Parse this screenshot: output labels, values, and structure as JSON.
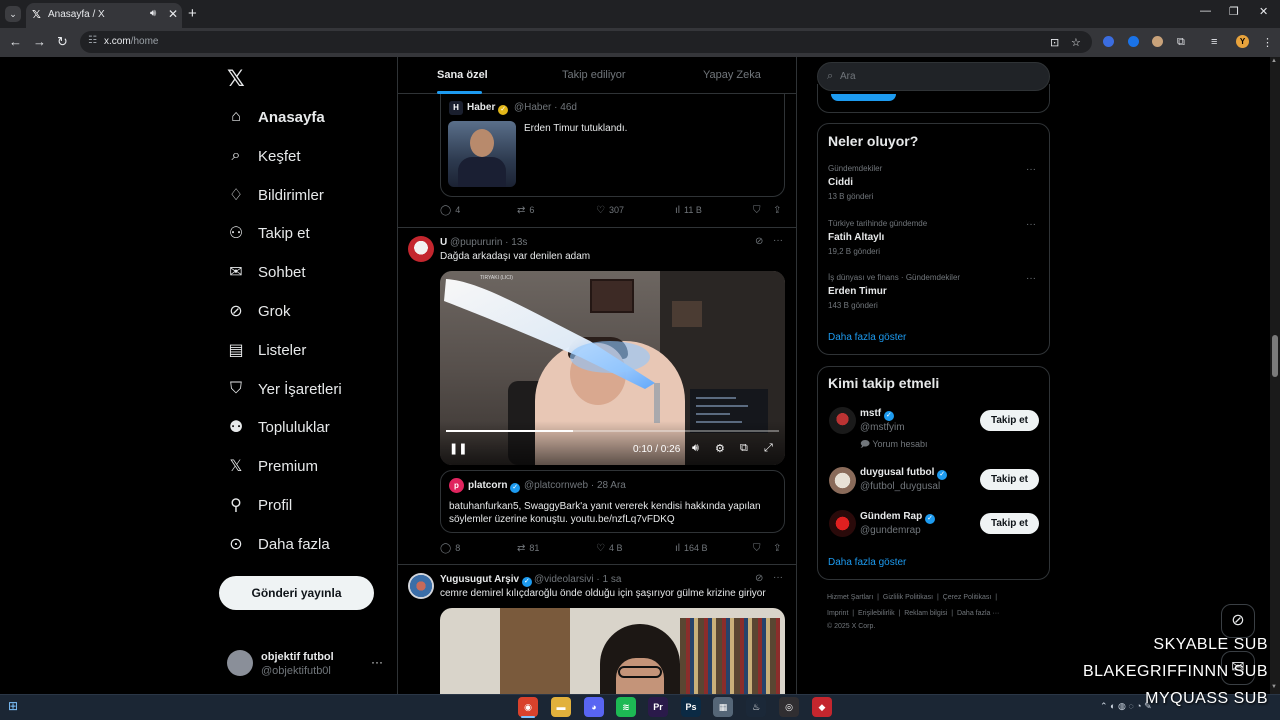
{
  "browser": {
    "tab_title": "Anasayfa / X",
    "tab_favicon": "𝕏",
    "url_domain": "x.com",
    "url_path": "/home",
    "profile_letter": "Y"
  },
  "sidebar": {
    "logo": "𝕏",
    "items": [
      {
        "label": "Anasayfa",
        "icon": "home-icon",
        "glyph": "⌂",
        "active": true
      },
      {
        "label": "Keşfet",
        "icon": "search-icon",
        "glyph": "⌕"
      },
      {
        "label": "Bildirimler",
        "icon": "bell-icon",
        "glyph": "♢"
      },
      {
        "label": "Takip et",
        "icon": "person-add-icon",
        "glyph": "⚇"
      },
      {
        "label": "Sohbet",
        "icon": "mail-icon",
        "glyph": "✉"
      },
      {
        "label": "Grok",
        "icon": "grok-icon",
        "glyph": "⊘"
      },
      {
        "label": "Listeler",
        "icon": "list-icon",
        "glyph": "▤"
      },
      {
        "label": "Yer İşaretleri",
        "icon": "bookmark-icon",
        "glyph": "⛉"
      },
      {
        "label": "Topluluklar",
        "icon": "communities-icon",
        "glyph": "⚉"
      },
      {
        "label": "Premium",
        "icon": "x-premium-icon",
        "glyph": "𝕏"
      },
      {
        "label": "Profil",
        "icon": "profile-icon",
        "glyph": "⚲"
      },
      {
        "label": "Daha fazla",
        "icon": "more-circle-icon",
        "glyph": "⊙"
      }
    ],
    "post_button": "Gönderi yayınla",
    "account": {
      "name": "objektif futbol",
      "handle": "@objektifutb0l",
      "more": "···"
    }
  },
  "timeline": {
    "tabs": [
      "Sana özel",
      "Takip ediliyor",
      "Yapay Zeka"
    ],
    "active_tab": "Sana özel",
    "post1": {
      "quote": {
        "avatar_letter": "H",
        "name": "Haber",
        "handle": "@Haber · 46d",
        "text": "Erden Timur tutuklandı."
      },
      "actions": {
        "replies": "4",
        "reposts": "6",
        "likes": "307",
        "views": "11 B"
      }
    },
    "post2": {
      "name": "U",
      "handle": "@pupururin · 13s",
      "text": "Dağda arkadaşı var denilen adam",
      "video": {
        "time": "0:10 / 0:26",
        "progress": 0.38,
        "tag": "TIRYAKI (LICI)"
      },
      "quote": {
        "avatar_letter": "p",
        "name": "platcorn",
        "handle": "@platcornweb · 28 Ara",
        "text": "batuhanfurkan5, SwaggyBark'a yanıt vererek kendisi hakkında yapılan söylemler üzerine konuştu. youtu.be/nzfLq7vFDKQ"
      },
      "actions": {
        "replies": "8",
        "reposts": "81",
        "likes": "4 B",
        "views": "164 B"
      }
    },
    "post3": {
      "name": "Yugusugut Arşiv",
      "handle": "@videolarsivi · 1 sa",
      "text": "cemre demirel kılıçdaroğlu önde olduğu için şaşırıyor gülme krizine giriyor"
    }
  },
  "right": {
    "search_placeholder": "Ara",
    "trends": {
      "title": "Neler oluyor?",
      "items": [
        {
          "meta": "Gündemdekiler",
          "title": "Ciddi",
          "count": "13 B gönderi"
        },
        {
          "meta": "Türkiye tarihinde gündemde",
          "title": "Fatih Altaylı",
          "count": "19,2 B gönderi"
        },
        {
          "meta": "İş dünyası ve finans · Gündemdekiler",
          "title": "Erden Timur",
          "count": "143 B gönderi"
        }
      ],
      "show_more": "Daha fazla göster"
    },
    "follow": {
      "title": "Kimi takip etmeli",
      "items": [
        {
          "name": "mstf",
          "handle": "@mstfyim",
          "sub": "Yorum hesabı",
          "button": "Takip et"
        },
        {
          "name": "duygusal futbol",
          "handle": "@futbol_duygusal",
          "button": "Takip et"
        },
        {
          "name": "Gündem Rap",
          "handle": "@gundemrap",
          "button": "Takip et"
        }
      ],
      "show_more": "Daha fazla göster"
    },
    "footer": {
      "row1": [
        "Hizmet Şartları",
        "Gizlilik Politikası",
        "Çerez Politikası"
      ],
      "row2": [
        "Imprint",
        "Erişilebilirlik",
        "Reklam bilgisi",
        "Daha fazla ···"
      ],
      "copyright": "© 2025 X Corp."
    }
  },
  "overlay": {
    "lines": [
      "SKYABLE SUB",
      "BLAKEGRIFFINNN SUB",
      "MYQUASS SUB"
    ]
  },
  "taskbar": {
    "apps": [
      {
        "name": "chrome",
        "glyph": "◉",
        "color": "#d9422c"
      },
      {
        "name": "explorer",
        "glyph": "▬",
        "color": "#e2b13c"
      },
      {
        "name": "discord",
        "glyph": "◕",
        "color": "#5865f2"
      },
      {
        "name": "spotify",
        "glyph": "≋",
        "color": "#1db954"
      },
      {
        "name": "premiere",
        "glyph": "Pr",
        "color": "#2a1a4a"
      },
      {
        "name": "photoshop",
        "glyph": "Ps",
        "color": "#0b2a44"
      },
      {
        "name": "app",
        "glyph": "▦",
        "color": "#556677"
      },
      {
        "name": "steam",
        "glyph": "♨",
        "color": "#1b2838"
      },
      {
        "name": "obs",
        "glyph": "◎",
        "color": "#302e31"
      },
      {
        "name": "app2",
        "glyph": "◆",
        "color": "#c4262e"
      }
    ]
  }
}
